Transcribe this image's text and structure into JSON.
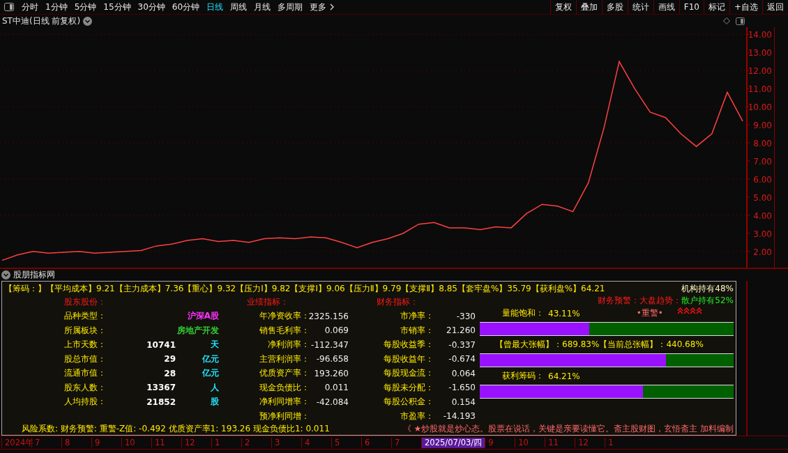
{
  "toolbar": {
    "periods": [
      {
        "label": "分时",
        "selected": false
      },
      {
        "label": "1分钟",
        "selected": false
      },
      {
        "label": "5分钟",
        "selected": false
      },
      {
        "label": "15分钟",
        "selected": false
      },
      {
        "label": "30分钟",
        "selected": false
      },
      {
        "label": "60分钟",
        "selected": false
      },
      {
        "label": "日线",
        "selected": true
      },
      {
        "label": "周线",
        "selected": false
      },
      {
        "label": "月线",
        "selected": false
      },
      {
        "label": "多周期",
        "selected": false
      },
      {
        "label": "更多",
        "selected": false
      }
    ],
    "buttons": [
      "复权",
      "叠加",
      "多股",
      "统计",
      "画线",
      "F10",
      "标记",
      "+自选",
      "返回"
    ]
  },
  "chart": {
    "title": "ST中迪(日线 前复权)",
    "chart_data": {
      "type": "line",
      "grid": true,
      "ylim": [
        1.1,
        14.4
      ],
      "yticks": [
        {
          "value": 14,
          "label": "14.00"
        },
        {
          "value": 13,
          "label": "13.00"
        },
        {
          "value": 12,
          "label": "12.00"
        },
        {
          "value": 11,
          "label": "11.00"
        },
        {
          "value": 10,
          "label": "10.00"
        },
        {
          "value": 9,
          "label": "9.00"
        },
        {
          "value": 8,
          "label": "8.00"
        },
        {
          "value": 7,
          "label": "7.00"
        },
        {
          "value": 6,
          "label": "6.00"
        },
        {
          "value": 5,
          "label": "5.00"
        },
        {
          "value": 4,
          "label": "4.00"
        },
        {
          "value": 3,
          "label": "3.00"
        },
        {
          "value": 2,
          "label": "2.00"
        }
      ],
      "values": [
        1.5,
        1.8,
        2.0,
        1.9,
        1.95,
        2.0,
        1.9,
        1.95,
        2.0,
        2.05,
        2.3,
        2.4,
        2.6,
        2.7,
        2.55,
        2.6,
        2.5,
        2.7,
        2.75,
        2.7,
        2.8,
        2.75,
        2.5,
        2.2,
        2.5,
        2.7,
        3.0,
        3.5,
        3.6,
        3.3,
        3.3,
        3.2,
        3.35,
        3.3,
        4.1,
        4.6,
        4.5,
        4.2,
        5.8,
        8.8,
        12.5,
        11.0,
        9.7,
        9.4,
        8.5,
        7.8,
        8.5,
        10.8,
        9.2
      ]
    }
  },
  "panel": {
    "title": "股朋指标网",
    "chips": "【筹码：】【平均成本】9.21【主力成本】7.36【重心】9.32【压力Ⅰ】9.82【支撑Ⅰ】9.06【压力Ⅱ】9.79【支撑Ⅱ】8.85【套牢盘%】35.79【获利盘%】64.21",
    "institution": "机构持有48%",
    "sections": [
      {
        "header": "股东股份：",
        "rows": [
          {
            "label": "品种类型：",
            "value": "沪深A股",
            "color": "#ff33ff"
          },
          {
            "label": "所属板块：",
            "value": "房地产开发",
            "color": "#33cc33"
          },
          {
            "label": "上市天数：",
            "value": "10741",
            "unit": "天",
            "color": "#ffffff"
          },
          {
            "label": "股总市值：",
            "value": "29",
            "unit": "亿元",
            "color": "#ffffff"
          },
          {
            "label": "流通市值：",
            "value": "28",
            "unit": "亿元",
            "color": "#ffffff"
          },
          {
            "label": "股东人数：",
            "value": "13367",
            "unit": "人",
            "color": "#ffffff"
          },
          {
            "label": "人均持股：",
            "value": "21852",
            "unit": "股",
            "color": "#ffffff"
          }
        ]
      },
      {
        "header": "业绩指标：",
        "rows": [
          {
            "label": "年净资收率：",
            "value": "2325.156"
          },
          {
            "label": "销售毛利率：",
            "value": "0.069"
          },
          {
            "label": "净利润率：",
            "value": "-112.347"
          },
          {
            "label": "主营利润率：",
            "value": "-96.658"
          },
          {
            "label": "优质资产率：",
            "value": "193.260"
          },
          {
            "label": "现金负债比：",
            "value": "0.011"
          },
          {
            "label": "净利同增率：",
            "value": "-42.084"
          },
          {
            "label": "预净利同增："
          }
        ]
      },
      {
        "header": "财务指标：",
        "rows": [
          {
            "label": "市净率：",
            "value": "-330"
          },
          {
            "label": "市销率：",
            "value": "21.260"
          },
          {
            "label": "每股收益季：",
            "value": "-0.337"
          },
          {
            "label": "每股收益年：",
            "value": "-0.674"
          },
          {
            "label": "每股现金流：",
            "value": "0.064"
          },
          {
            "label": "每股未分配：",
            "value": "-1.650"
          },
          {
            "label": "每股公积金：",
            "value": "0.154"
          },
          {
            "label": "市盈率：",
            "value": "-14.193"
          }
        ]
      }
    ],
    "alerts": {
      "finance": "财务预警：",
      "market": "大盘趋势：",
      "retail": "散户持有52%",
      "warning": "•重警•"
    },
    "meters": [
      {
        "label": "量能饱和：",
        "reading": "43.11%",
        "level": 0.4311
      },
      {
        "label": "【曾最大张幅】：689.83%【当前总张幅】：440.68%",
        "level": 0.734
      },
      {
        "label": "获利筹码：",
        "reading": "64.21%",
        "level": 0.6421
      }
    ],
    "risk": "风险系数: 财务预警: 重警-Z值: -0.492 优质资产率1: 193.26 现金负债比1: 0.011",
    "ticker": "《 ★炒股就是炒心态。股票在说话，关键是亲要读懂它。斋主股财图，玄悟斋主 加料编制"
  },
  "date_axis": [
    {
      "label": "2024年",
      "selected": false
    },
    {
      "label": "7",
      "selected": false
    },
    {
      "label": "8",
      "selected": false
    },
    {
      "label": "9",
      "selected": false
    },
    {
      "label": "10",
      "selected": false
    },
    {
      "label": "11",
      "selected": false
    },
    {
      "label": "12",
      "selected": false
    },
    {
      "label": "1",
      "selected": false
    },
    {
      "label": "2",
      "selected": false
    },
    {
      "label": "3",
      "selected": false
    },
    {
      "label": "4",
      "selected": false
    },
    {
      "label": "5",
      "selected": false
    },
    {
      "label": "6",
      "selected": false
    },
    {
      "label": "7",
      "selected": false
    },
    {
      "label": "2025/07/03/四",
      "selected": true
    },
    {
      "label": "9",
      "selected": false
    },
    {
      "label": "10",
      "selected": false
    },
    {
      "label": "11",
      "selected": false
    },
    {
      "label": "12",
      "selected": false
    },
    {
      "label": "1",
      "selected": false
    }
  ]
}
